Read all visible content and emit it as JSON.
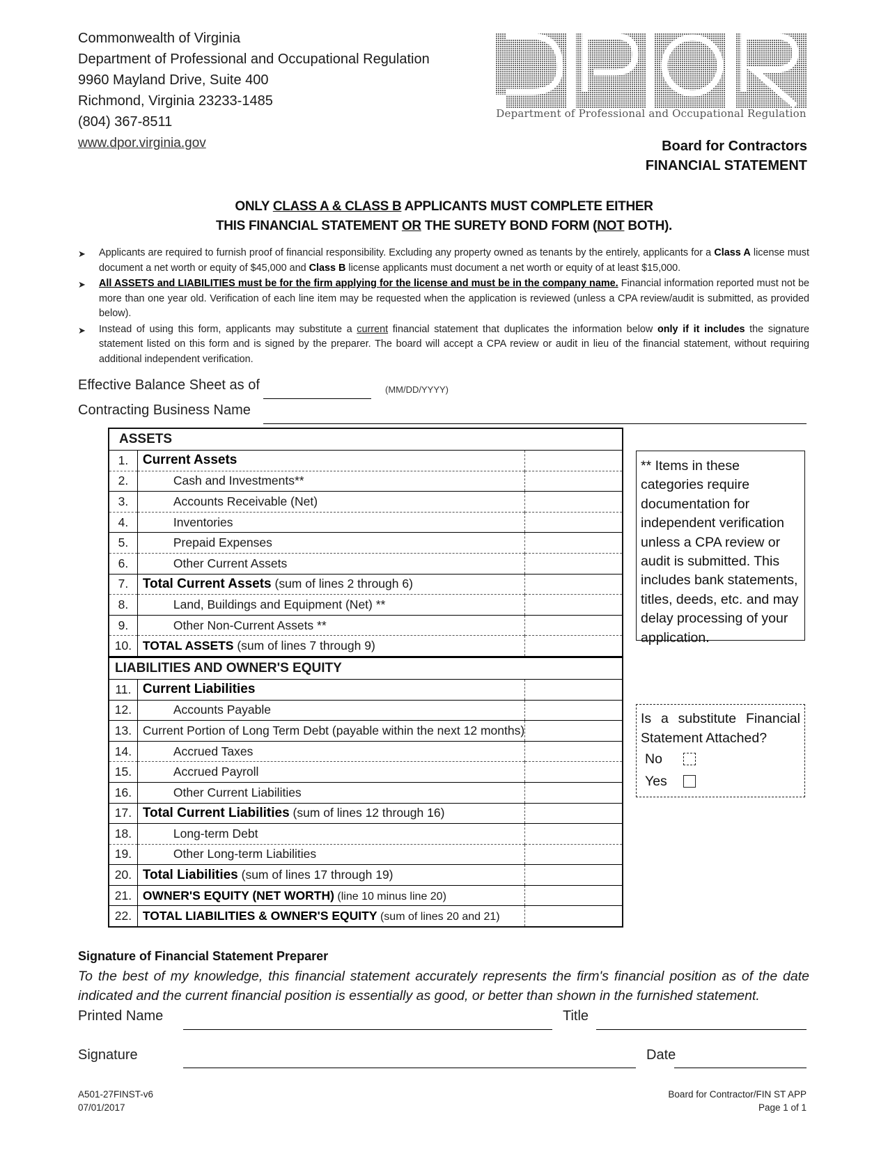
{
  "header": {
    "address_lines": [
      "Commonwealth of Virginia",
      "Department of Professional and Occupational Regulation",
      "9960 Mayland Drive, Suite 400",
      "Richmond, Virginia 23233-1485",
      "(804) 367-8511"
    ],
    "website": "www.dpor.virginia.gov",
    "logo_letters": [
      "D",
      "P",
      "O",
      "R"
    ],
    "logo_caption": "Department of Professional and Occupational Regulation",
    "board": "Board for Contractors",
    "form_title": "FINANCIAL STATEMENT"
  },
  "banner": {
    "l1_a": "ONLY ",
    "l1_u": "CLASS A & CLASS B",
    "l1_b": " APPLICANTS MUST COMPLETE EITHER",
    "l2_a": "THIS FINANCIAL STATEMENT ",
    "l2_u1": "OR",
    "l2_b": " THE SURETY BOND FORM (",
    "l2_u2": "NOT",
    "l2_c": " BOTH)."
  },
  "bullets": {
    "b1_a": "Applicants are required to furnish proof of financial responsibility. Excluding any property owned as tenants by the entirely, applicants for a ",
    "b1_bold1": "Class A",
    "b1_b": " license must document a net worth or equity of $45,000 and ",
    "b1_bold2": "Class B",
    "b1_c": " license applicants must document a net worth or equity of at least $15,000.",
    "b2_bold_u": "All ASSETS and LIABILITIES must be for the firm applying for the license and must be in the company name.",
    "b2_a": "  Financial information reported must not be more than one year old.  Verification of each line item may be requested when the application is reviewed (unless a CPA review/audit is submitted, as provided below).",
    "b3_a": "Instead of using this form, applicants may substitute a ",
    "b3_u": "current",
    "b3_b": " financial statement that duplicates the information below ",
    "b3_bold": "only if it includes",
    "b3_c": " the signature statement listed on this form and is signed by the preparer.  The board will accept a CPA review or audit in lieu of the financial statement, without requiring additional independent verification."
  },
  "fields": {
    "balance_sheet_label": "Effective Balance Sheet as of",
    "balance_sheet_value": "",
    "date_hint": "(MM/DD/YYYY)",
    "business_name_label": "Contracting Business Name",
    "business_name_value": ""
  },
  "table": {
    "assets_header": "ASSETS",
    "liabilities_header": "LIABILITIES AND OWNER'S EQUITY",
    "rows": [
      {
        "num": "1.",
        "bold": "Current Assets",
        "text": "",
        "value": ""
      },
      {
        "num": "2.",
        "bold": "",
        "text": "Cash and Investments**",
        "value": ""
      },
      {
        "num": "3.",
        "bold": "",
        "text": "Accounts Receivable (Net)",
        "value": ""
      },
      {
        "num": "4.",
        "bold": "",
        "text": "Inventories",
        "value": ""
      },
      {
        "num": "5.",
        "bold": "",
        "text": "Prepaid Expenses",
        "value": ""
      },
      {
        "num": "6.",
        "bold": "",
        "text": "Other Current Assets",
        "value": ""
      },
      {
        "num": "7.",
        "bold": "Total Current Assets",
        "text": " (sum of lines 2 through 6)",
        "value": ""
      },
      {
        "num": "8.",
        "bold": "",
        "text": "Land, Buildings and Equipment (Net) **",
        "value": ""
      },
      {
        "num": "9.",
        "bold": "",
        "text": "Other Non-Current Assets  **",
        "value": ""
      },
      {
        "num": "10.",
        "bold": "TOTAL ASSETS",
        "text": " (sum of lines 7 through 9)",
        "value": ""
      },
      {
        "num": "11.",
        "bold": "Current Liabilities",
        "text": "",
        "value": ""
      },
      {
        "num": "12.",
        "bold": "",
        "text": "Accounts Payable",
        "value": ""
      },
      {
        "num": "13.",
        "bold": "",
        "text": "Current Portion of Long Term Debt (payable within the next 12 months)",
        "value": ""
      },
      {
        "num": "14.",
        "bold": "",
        "text": "Accrued Taxes",
        "value": ""
      },
      {
        "num": "15.",
        "bold": "",
        "text": "Accrued Payroll",
        "value": ""
      },
      {
        "num": "16.",
        "bold": "",
        "text": "Other Current Liabilities",
        "value": ""
      },
      {
        "num": "17.",
        "bold": "Total Current Liabilities",
        "text": " (sum of lines 12 through 16)",
        "value": ""
      },
      {
        "num": "18.",
        "bold": "",
        "text": "Long-term Debt",
        "value": ""
      },
      {
        "num": "19.",
        "bold": "",
        "text": "Other Long-term Liabilities",
        "value": ""
      },
      {
        "num": "20.",
        "bold": "Total Liabilities",
        "text": " (sum of lines 17 through 19)",
        "value": ""
      },
      {
        "num": "21.",
        "bold": "OWNER'S EQUITY (NET WORTH)",
        "text": "  (line 10 minus line 20)",
        "value": ""
      },
      {
        "num": "22.",
        "bold": "TOTAL LIABILITIES & OWNER'S EQUITY",
        "text": "   (sum of lines 20 and 21)",
        "value": ""
      }
    ]
  },
  "side_note": "** Items in these categories require documentation for independent verification unless a CPA review or audit is submitted.  This includes bank statements, titles, deeds, etc. and may delay processing of your application.",
  "substitute": {
    "question_l1": "Is a substitute Financial",
    "question_l2": "Statement Attached?",
    "options": [
      {
        "label": "No",
        "checked": false
      },
      {
        "label": "Yes",
        "checked": false
      }
    ]
  },
  "signature": {
    "heading": "Signature of Financial Statement Preparer",
    "statement": "To the best of my knowledge, this financial statement accurately represents the firm's financial position as of the date indicated  and the current financial position is essentially as good, or better than shown in the furnished statement.",
    "printed_name_label": "Printed Name",
    "title_label": "Title",
    "signature_label": "Signature",
    "date_label": "Date"
  },
  "footer": {
    "form_id": "A501-27FINST-v6",
    "form_date": "07/01/2017",
    "right_l1": "Board for Contractor/FIN ST APP",
    "right_l2": "Page 1 of 1"
  }
}
